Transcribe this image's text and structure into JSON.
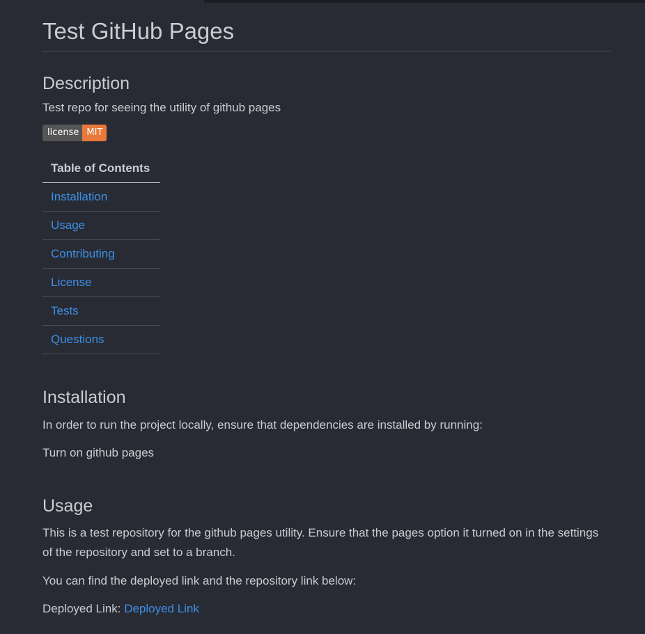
{
  "page": {
    "title": "Test GitHub Pages"
  },
  "description": {
    "heading": "Description",
    "text": "Test repo for seeing the utility of github pages",
    "badge": {
      "label": "license",
      "value": "MIT",
      "label_color": "#555555",
      "value_color": "#e8793a"
    }
  },
  "toc": {
    "header": "Table of Contents",
    "items": [
      {
        "label": "Installation"
      },
      {
        "label": "Usage"
      },
      {
        "label": "Contributing"
      },
      {
        "label": "License"
      },
      {
        "label": "Tests"
      },
      {
        "label": "Questions"
      }
    ]
  },
  "installation": {
    "heading": "Installation",
    "text": "In order to run the project locally, ensure that dependencies are installed by running:",
    "step": "Turn on github pages"
  },
  "usage": {
    "heading": "Usage",
    "text": "This is a test repository for the github pages utility. Ensure that the pages option it turned on in the settings of the repository and set to a branch.",
    "links_intro": "You can find the deployed link and the repository link below:",
    "deployed_label": "Deployed Link:",
    "deployed_link_text": "Deployed Link"
  },
  "colors": {
    "background": "#282b33",
    "text": "#c9ccd1",
    "link": "#3d8fe6"
  }
}
